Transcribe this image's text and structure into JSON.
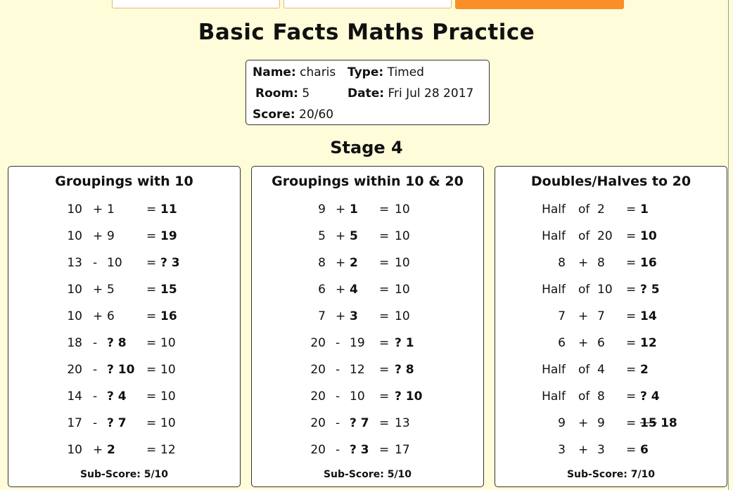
{
  "title": "Basic Facts Maths Practice",
  "info": {
    "name_label": "Name:",
    "name_value": "charis",
    "type_label": "Type:",
    "type_value": "Timed",
    "room_label": "Room:",
    "room_value": "5",
    "date_label": "Date:",
    "date_value": "Fri Jul 28 2017",
    "score_label": "Score:",
    "score_value": "20/60"
  },
  "stage": "Stage 4",
  "colors": {
    "background": "#fffcd9",
    "accent_button": "#fb8e26",
    "input_border": "#e2b777"
  },
  "panels": [
    {
      "title": "Groupings with 10",
      "subscore": "Sub-Score: 5/10",
      "rows": [
        {
          "a": "10",
          "op": "+",
          "b": "1",
          "eq": "=",
          "ans": "11"
        },
        {
          "a": "10",
          "op": "+",
          "b": "9",
          "eq": "=",
          "ans": "19"
        },
        {
          "a": "13",
          "op": "-",
          "b": "10",
          "eq": "=",
          "ans": "? 3"
        },
        {
          "a": "10",
          "op": "+",
          "b": "5",
          "eq": "=",
          "ans": "15"
        },
        {
          "a": "10",
          "op": "+",
          "b": "6",
          "eq": "=",
          "ans": "16"
        },
        {
          "a": "18",
          "op": "-",
          "b": "? 8",
          "eq": "=",
          "ans": "10"
        },
        {
          "a": "20",
          "op": "-",
          "b": "? 10",
          "eq": "=",
          "ans": "10"
        },
        {
          "a": "14",
          "op": "-",
          "b": "? 4",
          "eq": "=",
          "ans": "10"
        },
        {
          "a": "17",
          "op": "-",
          "b": "? 7",
          "eq": "=",
          "ans": "10"
        },
        {
          "a": "10",
          "op": "+",
          "b": "2",
          "eq": "=",
          "ans": "12"
        }
      ]
    },
    {
      "title": "Groupings within 10 & 20",
      "subscore": "Sub-Score: 5/10",
      "rows": [
        {
          "a": "9",
          "op": "+",
          "b": "1",
          "eq": "=",
          "ans": "10"
        },
        {
          "a": "5",
          "op": "+",
          "b": "5",
          "eq": "=",
          "ans": "10"
        },
        {
          "a": "8",
          "op": "+",
          "b": "2",
          "eq": "=",
          "ans": "10"
        },
        {
          "a": "6",
          "op": "+",
          "b": "4",
          "eq": "=",
          "ans": "10"
        },
        {
          "a": "7",
          "op": "+",
          "b": "3",
          "eq": "=",
          "ans": "10"
        },
        {
          "a": "20",
          "op": "-",
          "b": "19",
          "eq": "=",
          "ans": "? 1"
        },
        {
          "a": "20",
          "op": "-",
          "b": "12",
          "eq": "=",
          "ans": "? 8"
        },
        {
          "a": "20",
          "op": "-",
          "b": "10",
          "eq": "=",
          "ans": "? 10"
        },
        {
          "a": "20",
          "op": "-",
          "b": "? 7",
          "eq": "=",
          "ans": "13"
        },
        {
          "a": "20",
          "op": "-",
          "b": "? 3",
          "eq": "=",
          "ans": "17"
        }
      ]
    },
    {
      "title": "Doubles/Halves to 20",
      "subscore": "Sub-Score: 7/10",
      "rows": [
        {
          "a": "Half",
          "op": "of",
          "b": "2",
          "eq": "=",
          "ans": "1"
        },
        {
          "a": "Half",
          "op": "of",
          "b": "20",
          "eq": "=",
          "ans": "10"
        },
        {
          "a": "8",
          "op": "+",
          "b": "8",
          "eq": "=",
          "ans": "16"
        },
        {
          "a": "Half",
          "op": "of",
          "b": "10",
          "eq": "=",
          "ans": "? 5"
        },
        {
          "a": "7",
          "op": "+",
          "b": "7",
          "eq": "=",
          "ans": "14"
        },
        {
          "a": "6",
          "op": "+",
          "b": "6",
          "eq": "=",
          "ans": "12"
        },
        {
          "a": "Half",
          "op": "of",
          "b": "4",
          "eq": "=",
          "ans": "2"
        },
        {
          "a": "Half",
          "op": "of",
          "b": "8",
          "eq": "=",
          "ans": "? 4"
        },
        {
          "a": "9",
          "op": "+",
          "b": "9",
          "eq": "=",
          "ans_strike": "15",
          "ans": "18"
        },
        {
          "a": "3",
          "op": "+",
          "b": "3",
          "eq": "=",
          "ans": "6"
        }
      ]
    }
  ]
}
